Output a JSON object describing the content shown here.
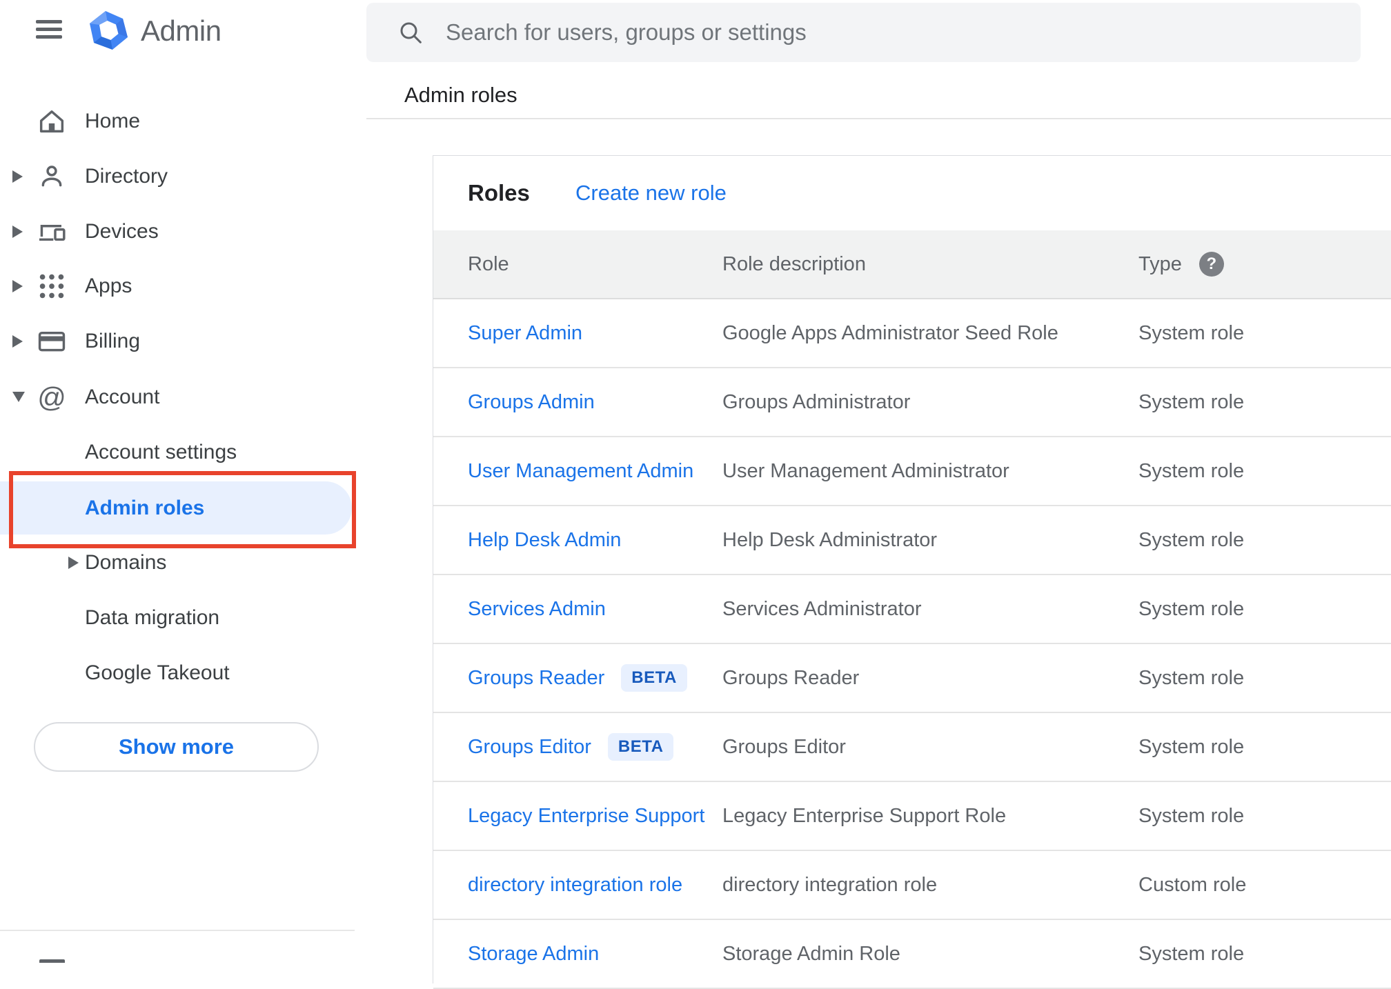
{
  "app": {
    "title": "Admin"
  },
  "search": {
    "placeholder": "Search for users, groups or settings"
  },
  "breadcrumb": {
    "label": "Admin roles"
  },
  "sidebar": {
    "items": [
      {
        "label": "Home"
      },
      {
        "label": "Directory"
      },
      {
        "label": "Devices"
      },
      {
        "label": "Apps"
      },
      {
        "label": "Billing"
      },
      {
        "label": "Account"
      }
    ],
    "account_children": [
      {
        "label": "Account settings"
      },
      {
        "label": "Admin roles",
        "selected": true
      },
      {
        "label": "Domains"
      },
      {
        "label": "Data migration"
      },
      {
        "label": "Google Takeout"
      }
    ],
    "show_more": "Show more"
  },
  "roles_card": {
    "title": "Roles",
    "create_link": "Create new role",
    "columns": {
      "role": "Role",
      "description": "Role description",
      "type": "Type"
    },
    "help_icon_glyph": "?",
    "rows": [
      {
        "role": "Super Admin",
        "description": "Google Apps Administrator Seed Role",
        "type": "System role"
      },
      {
        "role": "Groups Admin",
        "description": "Groups Administrator",
        "type": "System role"
      },
      {
        "role": "User Management Admin",
        "description": "User Management Administrator",
        "type": "System role"
      },
      {
        "role": "Help Desk Admin",
        "description": "Help Desk Administrator",
        "type": "System role"
      },
      {
        "role": "Services Admin",
        "description": "Services Administrator",
        "type": "System role"
      },
      {
        "role": "Groups Reader",
        "beta": "BETA",
        "description": "Groups Reader",
        "type": "System role"
      },
      {
        "role": "Groups Editor",
        "beta": "BETA",
        "description": "Groups Editor",
        "type": "System role"
      },
      {
        "role": "Legacy Enterprise Support",
        "description": "Legacy Enterprise Support Role",
        "type": "System role"
      },
      {
        "role": "directory integration role",
        "description": "directory integration role",
        "type": "Custom role"
      },
      {
        "role": "Storage Admin",
        "description": "Storage Admin Role",
        "type": "System role"
      }
    ]
  },
  "colors": {
    "link_blue": "#1a73e8",
    "selected_bg": "#e8f0fe",
    "annotation_red": "#e8432c",
    "beta_text": "#185abc",
    "beta_bg": "#e8f0fe",
    "table_header_bg": "#f1f2f2",
    "search_bg": "#f3f4f6",
    "icon_gray": "#5f6368"
  }
}
